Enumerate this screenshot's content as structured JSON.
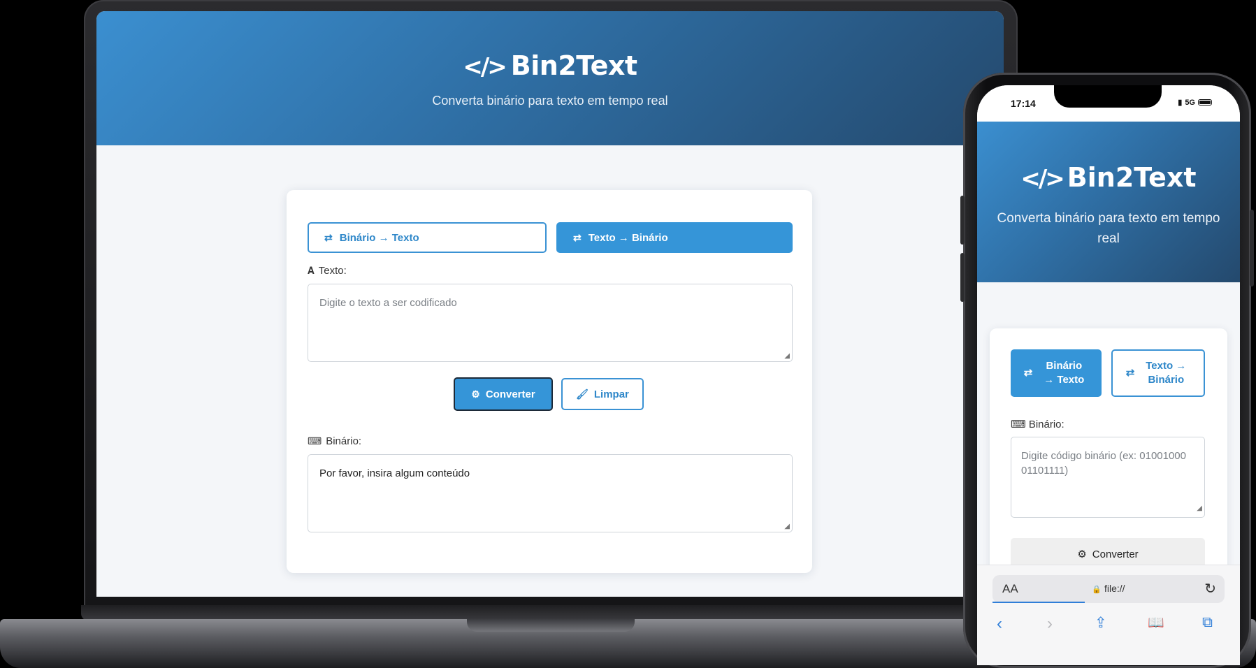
{
  "app": {
    "title": "Bin2Text",
    "code_icon": "</>",
    "subtitle": "Converta binário para texto em tempo real"
  },
  "desktop": {
    "tabs": [
      {
        "icon": "⇄",
        "label": "Binário → Texto",
        "active": false
      },
      {
        "icon": "⇄",
        "label": "Texto → Binário",
        "active": true
      }
    ],
    "input": {
      "icon": "𝐀",
      "label": "Texto:",
      "placeholder": "Digite o texto a ser codificado"
    },
    "buttons": {
      "convert_icon": "⚙",
      "convert_label": "Converter",
      "clear_icon": "🖌",
      "clear_label": "Limpar"
    },
    "output": {
      "icon": "⌨",
      "label": "Binário:",
      "value": "Por favor, insira algum conteúdo"
    }
  },
  "mobile": {
    "status": {
      "time": "17:14",
      "network": "5G"
    },
    "tabs": [
      {
        "icon": "⇄",
        "label": "Binário → Texto",
        "active": true
      },
      {
        "icon": "⇄",
        "label": "Texto → Binário",
        "active": false
      }
    ],
    "input": {
      "icon": "⌨",
      "label": "Binário:",
      "placeholder": "Digite código binário (ex: 01001000 01101111)"
    },
    "convert_icon": "⚙",
    "convert_label": "Converter",
    "browser": {
      "aa": "AA",
      "lock_icon": "🔒",
      "url": "file://",
      "reload_icon": "↻",
      "nav": {
        "back": "‹",
        "forward": "›",
        "share": "⇪",
        "bookmarks": "📖",
        "tabs": "⧉"
      }
    }
  },
  "colors": {
    "accent": "#3595d8",
    "hero_start": "#3b8fd0",
    "hero_end": "#24496d",
    "page_bg": "#f4f6f9"
  }
}
